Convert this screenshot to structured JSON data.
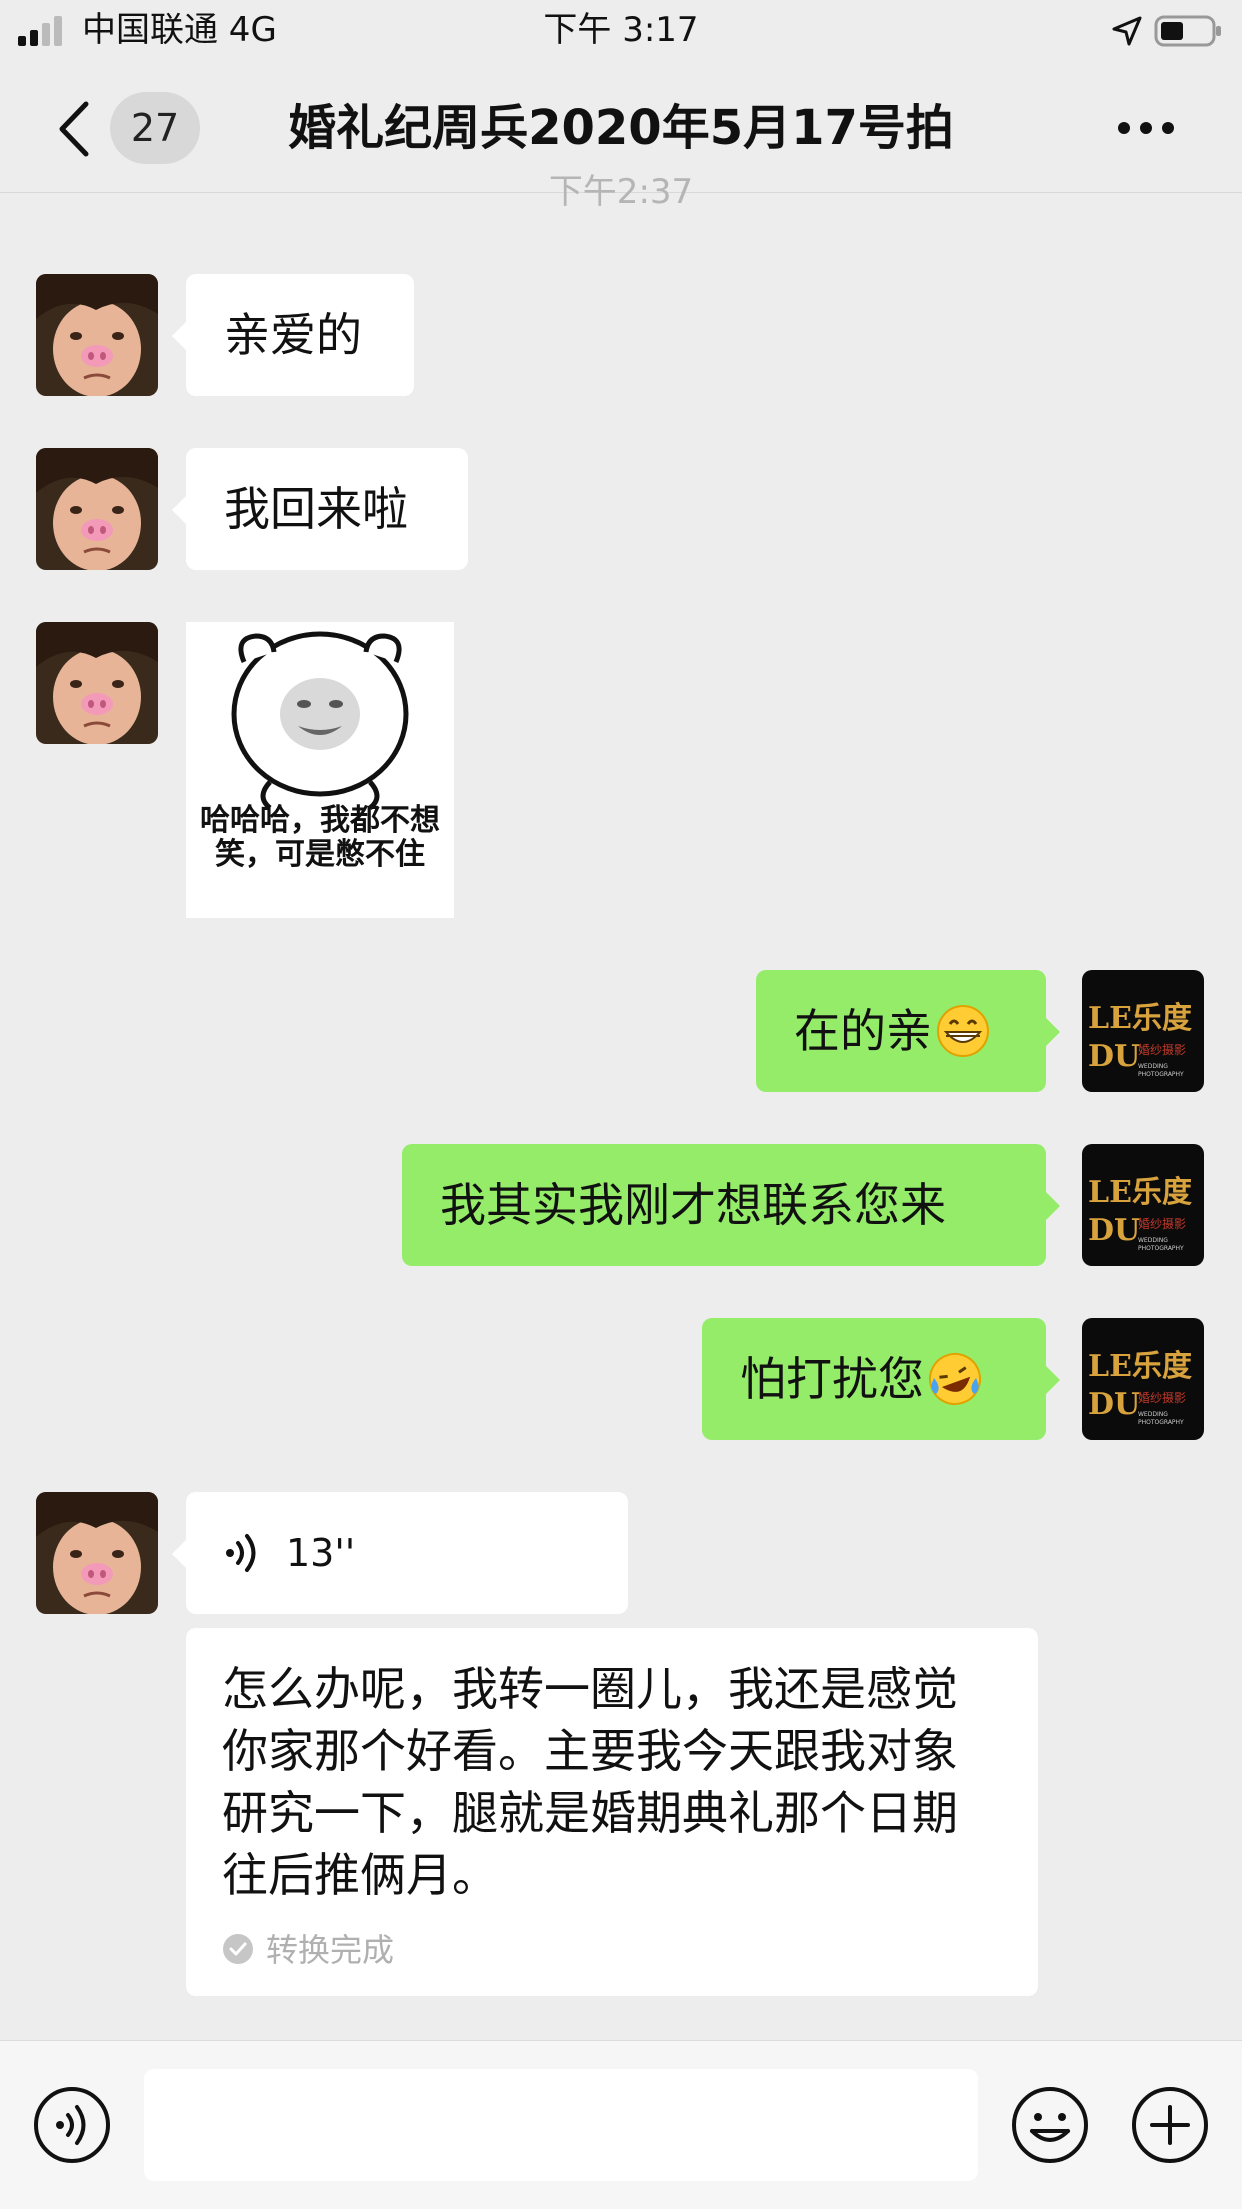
{
  "status_bar": {
    "carrier": "中国联通 4G",
    "time": "下午 3:17"
  },
  "nav": {
    "unread_count": "27",
    "title": "婚礼纪周兵2020年5月17号拍"
  },
  "chat": {
    "timestamp": "下午2:37",
    "messages": [
      {
        "sender": "contact",
        "text": "亲爱的"
      },
      {
        "sender": "contact",
        "text": "我回来啦"
      },
      {
        "sender": "contact",
        "type": "sticker",
        "text": "哈哈哈，我都不想笑，可是憋不住"
      },
      {
        "sender": "me",
        "text": "在的亲",
        "emoji": "grinning-face"
      },
      {
        "sender": "me",
        "text": "我其实我刚才想联系您来"
      },
      {
        "sender": "me",
        "text": "怕打扰您",
        "emoji": "rolling-on-floor-laughing"
      },
      {
        "sender": "contact",
        "type": "voice",
        "duration": "13''"
      }
    ],
    "transcript": {
      "text": "怎么办呢，我转一圈儿，我还是感觉你家那个好看。主要我今天跟我对象研究一下，腿就是婚期典礼那个日期往后推俩月。",
      "status": "转换完成"
    },
    "my_avatar": {
      "line1": "LE乐度",
      "line2": "DU",
      "sub": "婚纱摄影",
      "sub2": "WEDDING PHOTOGRAPHY"
    }
  },
  "input_bar": {
    "placeholder": ""
  },
  "colors": {
    "background": "#ededed",
    "bubble_out": "#95ec69",
    "bubble_in": "#ffffff",
    "brand_gold": "#d8a23c"
  }
}
